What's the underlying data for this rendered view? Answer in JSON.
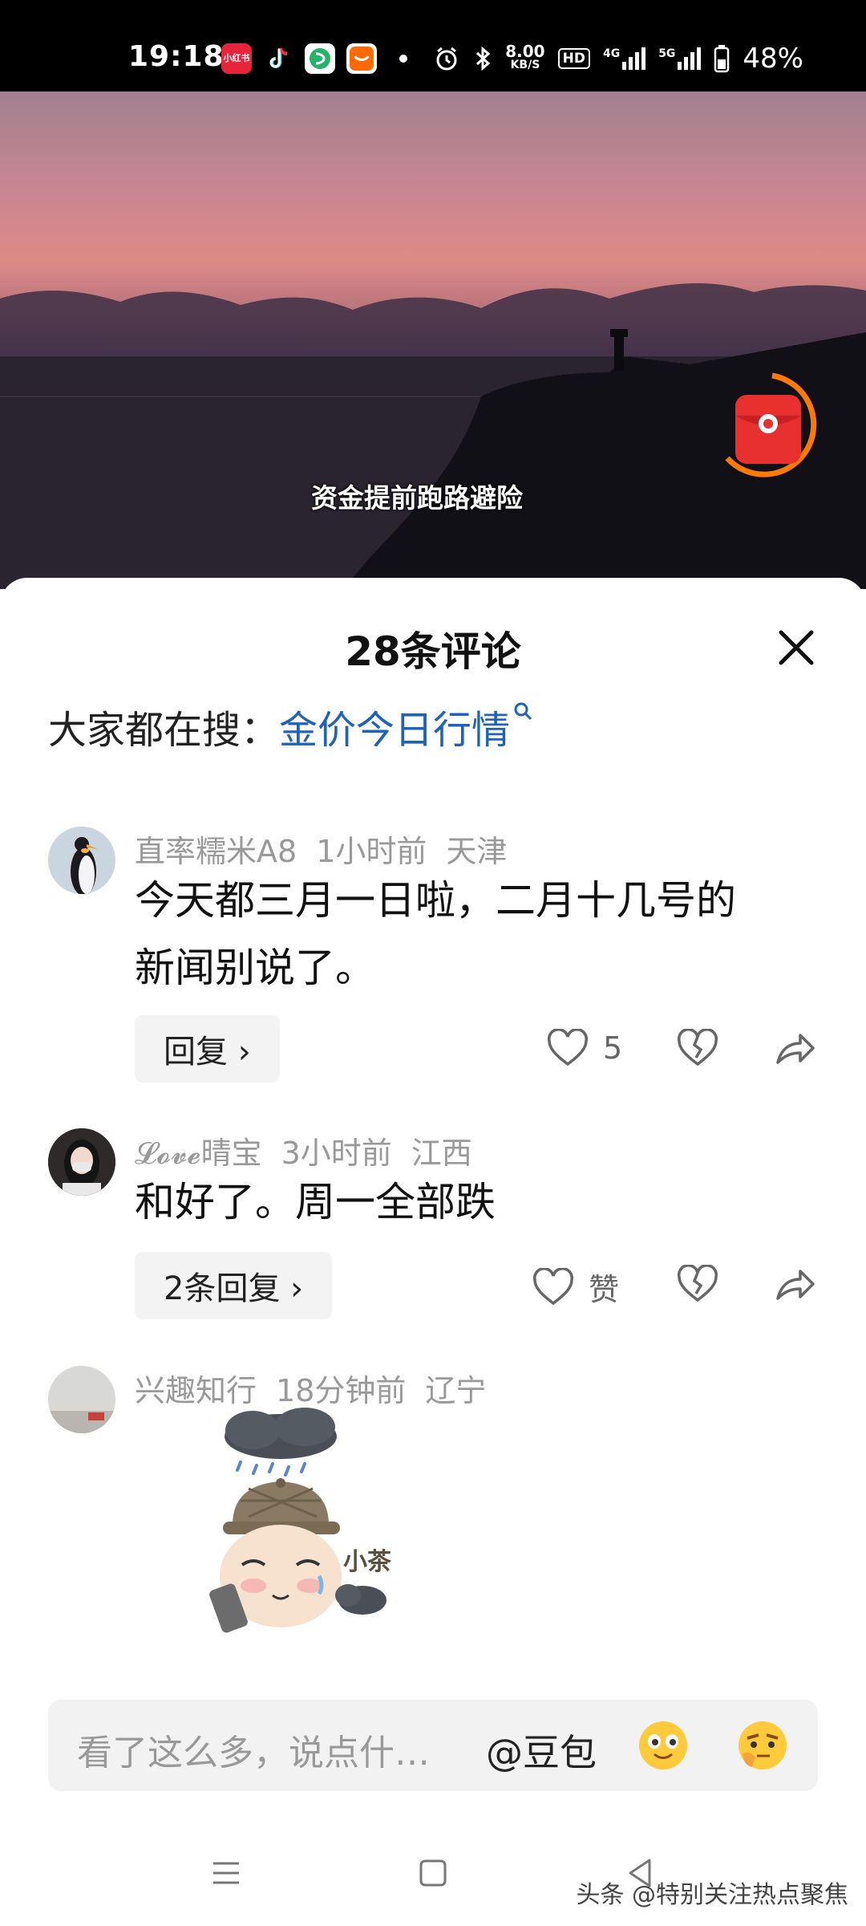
{
  "status_bar": {
    "time": "19:18",
    "app_icons": [
      "小红书",
      "抖音",
      "绿色应用",
      "淘宝特价"
    ],
    "net_speed_value": "8.00",
    "net_speed_unit": "KB/S",
    "hd_label": "HD",
    "sim1": "4G",
    "sim2": "5G",
    "battery": "48%"
  },
  "video": {
    "subtitle": "资金提前跑路避险"
  },
  "comments_sheet": {
    "title": "28条评论",
    "trending_prefix": "大家都在搜：",
    "trending_query": "金价今日行情",
    "comments": [
      {
        "username": "直率糯米A8",
        "time": "1小时前",
        "location": "天津",
        "text_line1": "今天都三月一日啦，二月十几号的",
        "text_line2": "新闻别说了。",
        "reply_label": "回复 ›",
        "like_count": "5"
      },
      {
        "username": "𝓛𝓸𝓿𝓮晴宝",
        "time": "3小时前",
        "location": "江西",
        "text_line1": "和好了。周一全部跌",
        "reply_label": "2条回复 ›",
        "like_count": "赞"
      },
      {
        "username": "兴趣知行",
        "time": "18分钟前",
        "location": "辽宁",
        "sticker_text": "小茶"
      }
    ]
  },
  "input_bar": {
    "placeholder": "看了这么多，说点什…",
    "at_label": "@豆包"
  },
  "watermark": "头条 @特别关注热点聚焦"
}
